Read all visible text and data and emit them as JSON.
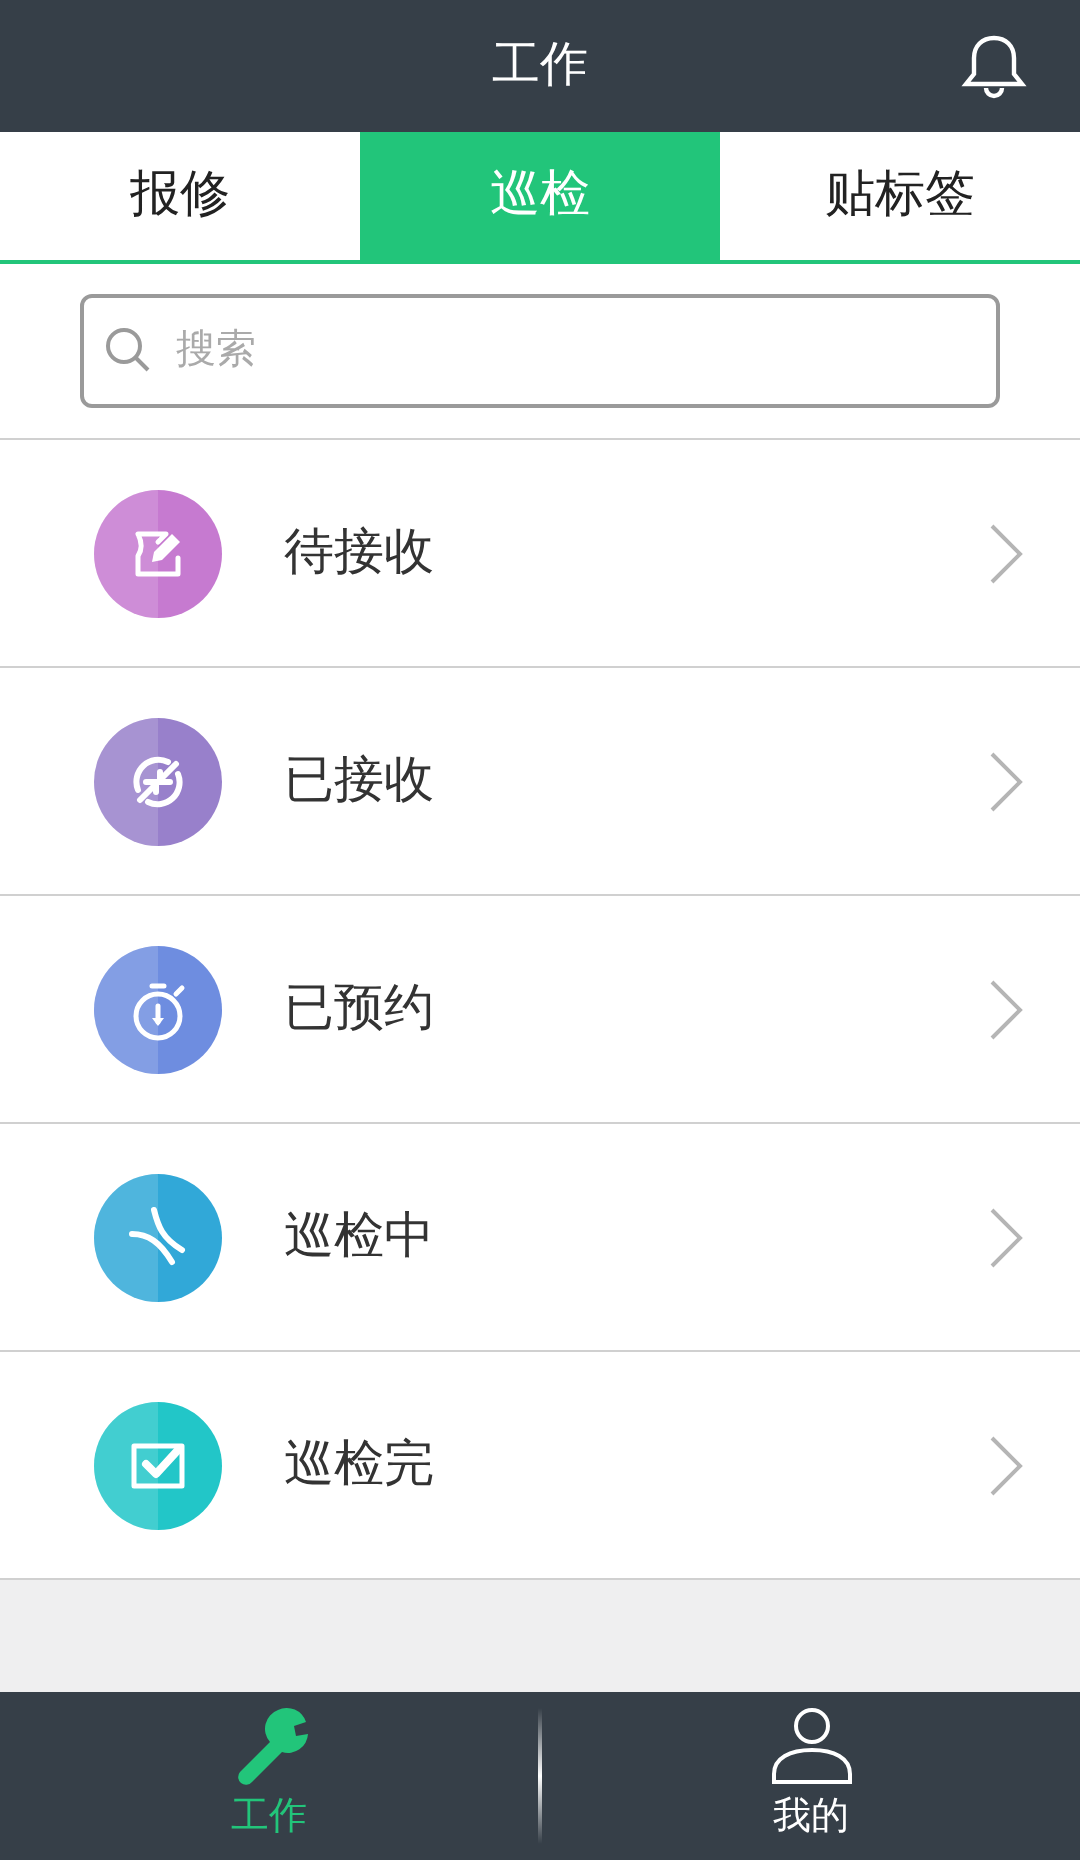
{
  "header": {
    "title": "工作"
  },
  "tabs": [
    {
      "label": "报修",
      "selected": false
    },
    {
      "label": "巡检",
      "selected": true
    },
    {
      "label": "贴标签",
      "selected": false
    }
  ],
  "search": {
    "placeholder": "搜索"
  },
  "items": [
    {
      "label": "待接收",
      "kind": "edit",
      "color": "#c67ad0"
    },
    {
      "label": "已接收",
      "kind": "sync",
      "color": "#9880cb"
    },
    {
      "label": "已预约",
      "kind": "timer",
      "color": "#6e8de0"
    },
    {
      "label": "巡检中",
      "kind": "pliers",
      "color": "#31a8d8"
    },
    {
      "label": "巡检完",
      "kind": "check",
      "color": "#22c6c8"
    }
  ],
  "bottom_nav": [
    {
      "label": "工作",
      "kind": "wrench",
      "selected": true
    },
    {
      "label": "我的",
      "kind": "person",
      "selected": false
    }
  ]
}
